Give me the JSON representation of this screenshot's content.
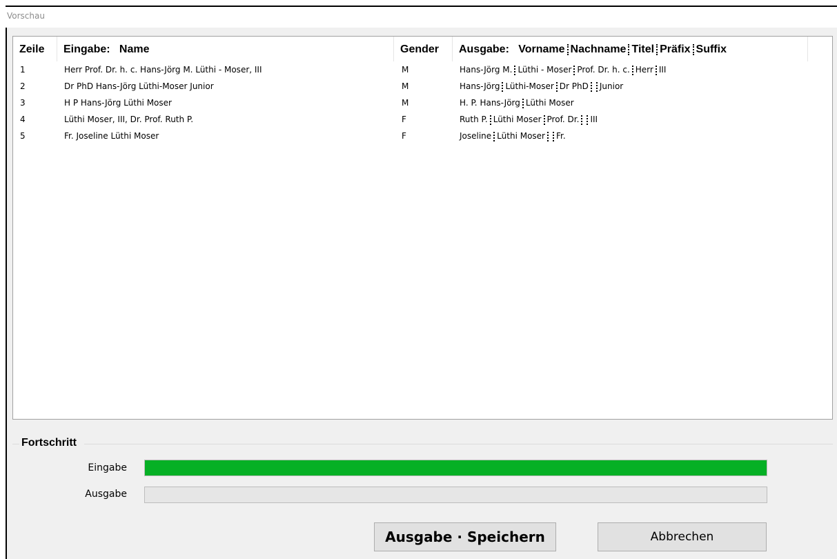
{
  "window": {
    "title": "Vorschau"
  },
  "table": {
    "columns": {
      "zeile": "Zeile",
      "eingabe": "Eingabe:   Name",
      "gender": "Gender",
      "ausgabe_prefix": "Ausgabe:",
      "ausgabe_parts": [
        "Vorname",
        "Nachname",
        "Titel",
        "Präfix",
        "Suffix"
      ]
    },
    "rows": [
      {
        "zeile": "1",
        "eingabe": "Herr Prof. Dr. h. c. Hans-Jörg M. Lüthi - Moser, III",
        "gender": "M",
        "ausgabe": [
          "Hans-Jörg M.",
          "Lüthi - Moser",
          "Prof. Dr. h. c.",
          "Herr",
          "III"
        ]
      },
      {
        "zeile": "2",
        "eingabe": "Dr PhD Hans-Jörg Lüthi-Moser Junior",
        "gender": "M",
        "ausgabe": [
          "Hans-Jörg",
          "Lüthi-Moser",
          "Dr PhD",
          "",
          "Junior"
        ]
      },
      {
        "zeile": "3",
        "eingabe": "H P Hans-Jörg Lüthi Moser",
        "gender": "M",
        "ausgabe": [
          "H. P. Hans-Jörg",
          "Lüthi Moser"
        ]
      },
      {
        "zeile": "4",
        "eingabe": "Lüthi Moser, III, Dr. Prof. Ruth P.",
        "gender": "F",
        "ausgabe": [
          "Ruth P.",
          "Lüthi Moser",
          "Prof. Dr.",
          "",
          "III"
        ]
      },
      {
        "zeile": "5",
        "eingabe": "Fr. Joseline Lüthi Moser",
        "gender": "F",
        "ausgabe": [
          "Joseline",
          "Lüthi Moser",
          "",
          "Fr."
        ]
      }
    ]
  },
  "progress": {
    "group_title": "Fortschritt",
    "eingabe_label": "Eingabe",
    "eingabe_value": 1.0,
    "ausgabe_label": "Ausgabe",
    "ausgabe_value": 0.0,
    "fill_color": "#06b025"
  },
  "buttons": {
    "save_label": "Ausgabe · Speichern",
    "cancel_label": "Abbrechen"
  }
}
